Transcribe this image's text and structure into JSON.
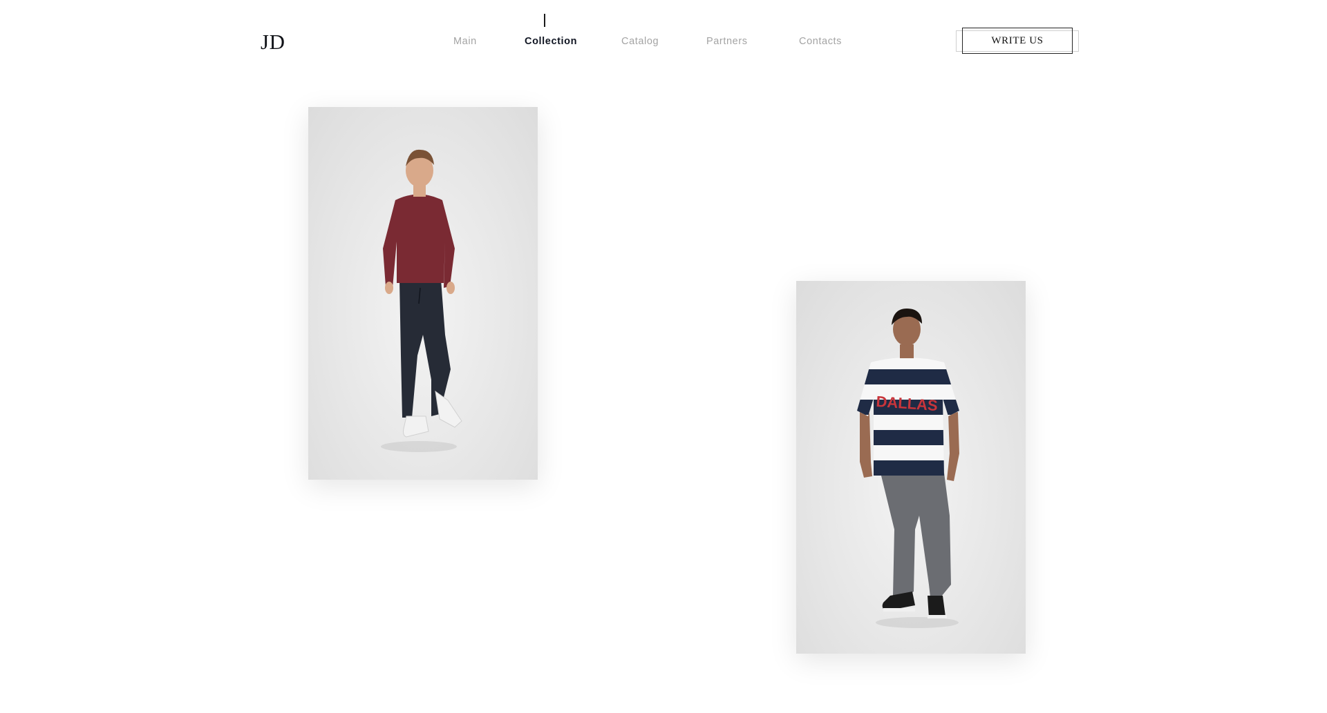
{
  "brand": {
    "logo_text": "JD"
  },
  "nav": {
    "items": [
      {
        "label": "Main",
        "active": false
      },
      {
        "label": "Collection",
        "active": true
      },
      {
        "label": "Catalog",
        "active": false
      },
      {
        "label": "Partners",
        "active": false
      },
      {
        "label": "Contacts",
        "active": false
      }
    ]
  },
  "header": {
    "cta_label": "WRITE US"
  },
  "products": [
    {
      "image_subject": "man in burgundy long-sleeve top, navy joggers, white sneakers",
      "colors": {
        "top": "#7a2a33",
        "pants": "#262b36",
        "shoes": "#f2f2f2"
      }
    },
    {
      "image_subject": "man in navy and white striped tee, grey joggers, black sneakers",
      "tee_print": "DALLAS",
      "colors": {
        "stripe_dark": "#1f2b45",
        "stripe_light": "#f7f7f7",
        "print": "#c8353b",
        "pants": "#6b6d72",
        "shoes": "#1b1b1b"
      }
    }
  ],
  "colors": {
    "background": "#ffffff",
    "nav_inactive": "#a3a3a3",
    "nav_active": "#101522",
    "card_bg": "#e6e6e6"
  }
}
